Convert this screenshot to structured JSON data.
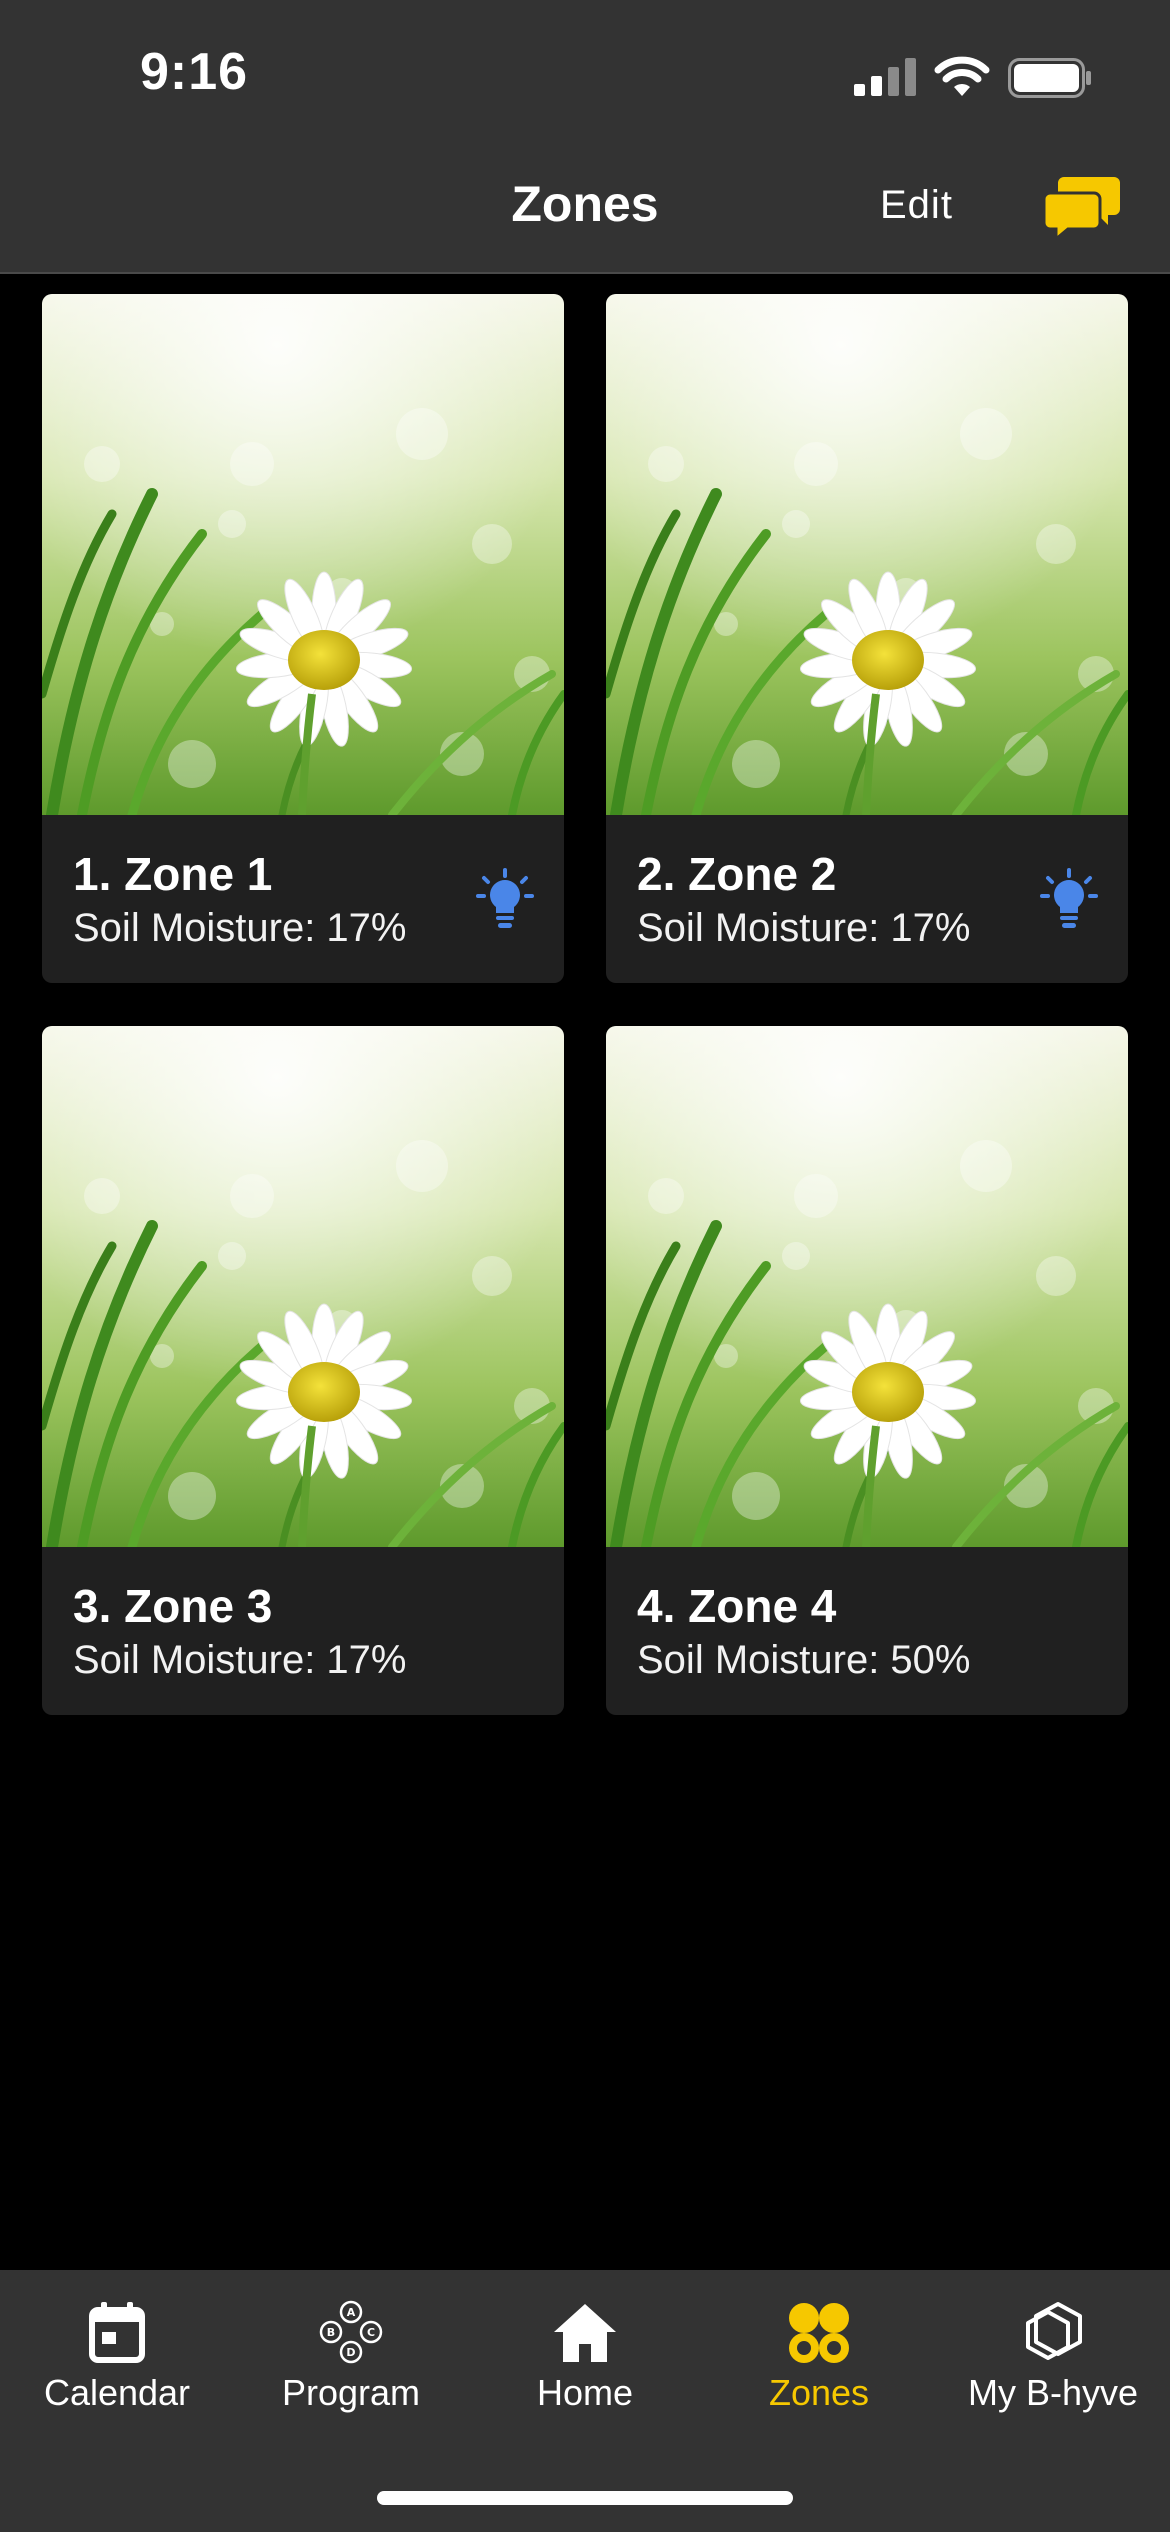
{
  "status_bar": {
    "time": "9:16"
  },
  "nav": {
    "title": "Zones",
    "edit_label": "Edit"
  },
  "colors": {
    "accent": "#f6c800",
    "bulb": "#4a86e8",
    "bar": "#333333",
    "card": "#202020"
  },
  "zones": [
    {
      "name": "1. Zone 1",
      "moisture": "Soil Moisture: 17%",
      "bulb": true
    },
    {
      "name": "2. Zone 2",
      "moisture": "Soil Moisture: 17%",
      "bulb": true
    },
    {
      "name": "3. Zone 3",
      "moisture": "Soil Moisture: 17%",
      "bulb": false
    },
    {
      "name": "4. Zone 4",
      "moisture": "Soil Moisture: 50%",
      "bulb": false
    }
  ],
  "tabs": [
    {
      "label": "Calendar",
      "icon": "calendar-icon",
      "active": false
    },
    {
      "label": "Program",
      "icon": "program-icon",
      "active": false
    },
    {
      "label": "Home",
      "icon": "home-icon",
      "active": false
    },
    {
      "label": "Zones",
      "icon": "zones-icon",
      "active": true
    },
    {
      "label": "My B-hyve",
      "icon": "b-hyve-icon",
      "active": false
    }
  ],
  "program_icon_letters": [
    "A",
    "B",
    "C",
    "D"
  ]
}
